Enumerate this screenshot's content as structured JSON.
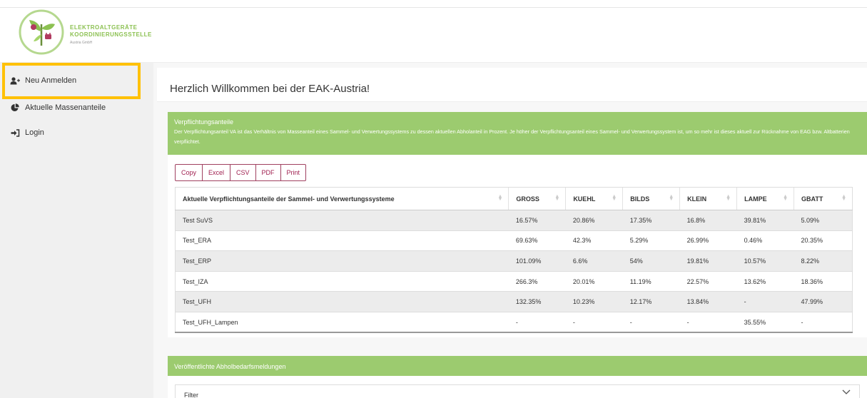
{
  "brand": {
    "line1": "ELEKTROALTGERÄTE",
    "line2": "KOORDINIERUNGSSTELLE",
    "line3": "Austria GmbH",
    "logo_icon": "plant-plug-logo"
  },
  "colors": {
    "accent_green": "#9ccb6f",
    "highlight": "#ffc107",
    "button_red": "#a02050"
  },
  "sidebar": {
    "items": [
      {
        "label": "Neu Anmelden",
        "icon": "user-plus-icon"
      },
      {
        "label": "Aktuelle Massenanteile",
        "icon": "pie-chart-icon"
      },
      {
        "label": "Login",
        "icon": "sign-in-icon"
      }
    ]
  },
  "main": {
    "title": "Herzlich Willkommen bei der EAK-Austria!",
    "card": {
      "title": "Verpflichtungsanteile",
      "description": "Der Verpflichtungsanteil VA ist das Verhältnis von Masseanteil eines Sammel- und Verwertungssystems zu dessen aktuellen Abholanteil in Prozent. Je höher der Verpflichtungsanteil eines Sammel- und Verwertungssystem ist, um so mehr ist dieses aktuell zur Rücknahme von EAG bzw. Altbatterien verpflichtet.",
      "buttons": [
        "Copy",
        "Excel",
        "CSV",
        "PDF",
        "Print"
      ],
      "table": {
        "headers": [
          "Aktuelle Verpflichtungsanteile der Sammel- und Verwertungssysteme",
          "GROSS",
          "KUEHL",
          "BILDS",
          "KLEIN",
          "LAMPE",
          "GBATT"
        ],
        "rows": [
          [
            "Test SuVS",
            "16.57%",
            "20.86%",
            "17.35%",
            "16.8%",
            "39.81%",
            "5.09%"
          ],
          [
            "Test_ERA",
            "69.63%",
            "42.3%",
            "5.29%",
            "26.99%",
            "0.46%",
            "20.35%"
          ],
          [
            "Test_ERP",
            "101.09%",
            "6.6%",
            "54%",
            "19.81%",
            "10.57%",
            "8.22%"
          ],
          [
            "Test_IZA",
            "266.3%",
            "20.01%",
            "11.19%",
            "22.57%",
            "13.62%",
            "18.36%"
          ],
          [
            "Test_UFH",
            "132.35%",
            "10.23%",
            "12.17%",
            "13.84%",
            "-",
            "47.99%"
          ],
          [
            "Test_UFH_Lampen",
            "-",
            "-",
            "-",
            "-",
            "35.55%",
            "-"
          ]
        ]
      }
    },
    "card2": {
      "title": "Veröffentlichte Abholbedarfsmeldungen",
      "filter_label": "Filter"
    }
  }
}
